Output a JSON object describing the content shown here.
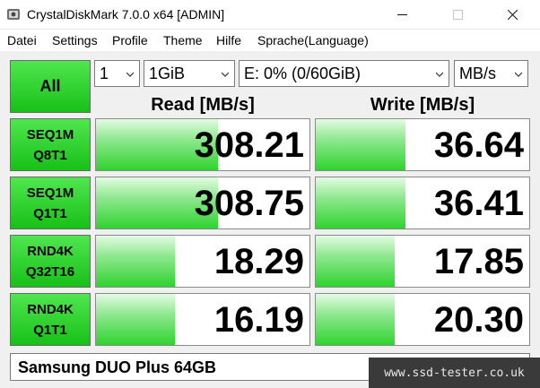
{
  "window": {
    "title": "CrystalDiskMark 7.0.0 x64 [ADMIN]"
  },
  "menu": [
    "Datei",
    "Settings",
    "Profile",
    "Theme",
    "Hilfe",
    "Sprache(Language)"
  ],
  "controls": {
    "all_label": "All",
    "count": "1",
    "size": "1GiB",
    "drive": "E: 0% (0/60GiB)",
    "unit": "MB/s"
  },
  "headers": {
    "read": "Read [MB/s]",
    "write": "Write [MB/s]"
  },
  "tests": [
    {
      "line1": "SEQ1M",
      "line2": "Q8T1",
      "read": "308.21",
      "write": "36.64",
      "read_fill": 0.57,
      "write_fill": 0.42
    },
    {
      "line1": "SEQ1M",
      "line2": "Q1T1",
      "read": "308.75",
      "write": "36.41",
      "read_fill": 0.57,
      "write_fill": 0.42
    },
    {
      "line1": "RND4K",
      "line2": "Q32T16",
      "read": "18.29",
      "write": "17.85",
      "read_fill": 0.37,
      "write_fill": 0.37
    },
    {
      "line1": "RND4K",
      "line2": "Q1T1",
      "read": "16.19",
      "write": "20.30",
      "read_fill": 0.37,
      "write_fill": 0.37
    }
  ],
  "comment": "Samsung DUO Plus 64GB",
  "watermark": "www.ssd-tester.co.uk",
  "colors": {
    "button_green": "#18c018",
    "bar_green": "#2fd32f",
    "background": "#f0f0f0"
  },
  "icons": {
    "app": "crystaldiskmark-icon",
    "dropdown": "chevron-down-icon"
  }
}
